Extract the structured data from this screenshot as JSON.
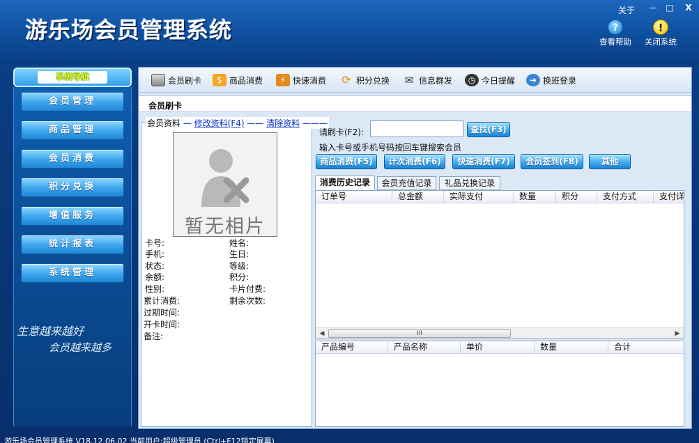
{
  "app": {
    "title": "游乐场会员管理系统"
  },
  "window": {
    "about": "关于",
    "minimize": "—",
    "maximize": "□",
    "close": "X"
  },
  "header_buttons": {
    "help": "查看帮助",
    "close_system": "关闭系统"
  },
  "icons": {
    "help": "help-icon",
    "warning": "warning-icon"
  },
  "nav": {
    "header": "系统导航",
    "items": [
      "会员管理",
      "商品管理",
      "会员消费",
      "积分兑换",
      "增值服务",
      "统计报表",
      "系统管理"
    ]
  },
  "slogan": {
    "line1": "生意越来越好",
    "line2": "会员越来越多"
  },
  "toolbar": [
    "会员刷卡",
    "商品消费",
    "快速消费",
    "积分兑换",
    "信息群发",
    "今日提醒",
    "换班登录"
  ],
  "section_title": "会员刷卡",
  "member": {
    "legend": "会员资料",
    "edit_link": "修改资料(F4)",
    "clear_link": "清除资料",
    "photo_text": "暂无相片",
    "fields_left": [
      "卡号:",
      "手机:",
      "状态:",
      "余额:",
      "性别:",
      "累计消费:",
      "过期时间:",
      "开卡时间:",
      "备注:"
    ],
    "fields_right": [
      "姓名:",
      "生日:",
      "等级:",
      "积分:",
      "卡片付费:",
      "剩余次数:"
    ]
  },
  "swipe": {
    "label": "请刷卡(F2):",
    "input_value": "",
    "search_btn": "查找(F3)",
    "hint": "输入卡号或手机号码按回车键搜索会员"
  },
  "actions": [
    "商品消费(F5)",
    "计次消费(F6)",
    "快速消费(F7)",
    "会员签到(F8)",
    "其他"
  ],
  "tabs": [
    "消费历史记录",
    "会员充值记录",
    "礼品兑换记录"
  ],
  "grid1_columns": [
    "订单号",
    "总金额",
    "实际支付",
    "数量",
    "积分",
    "支付方式",
    "支付详"
  ],
  "scrollbar": {
    "left": "◀",
    "right": "▶",
    "thumb": "III"
  },
  "grid2_columns": [
    "产品编号",
    "产品名称",
    "单价",
    "数量",
    "合计"
  ],
  "status_bar": "游乐场会员管理系统 V18.12.06.02  当前用户:超级管理员  (Ctrl+F12锁定屏幕)"
}
